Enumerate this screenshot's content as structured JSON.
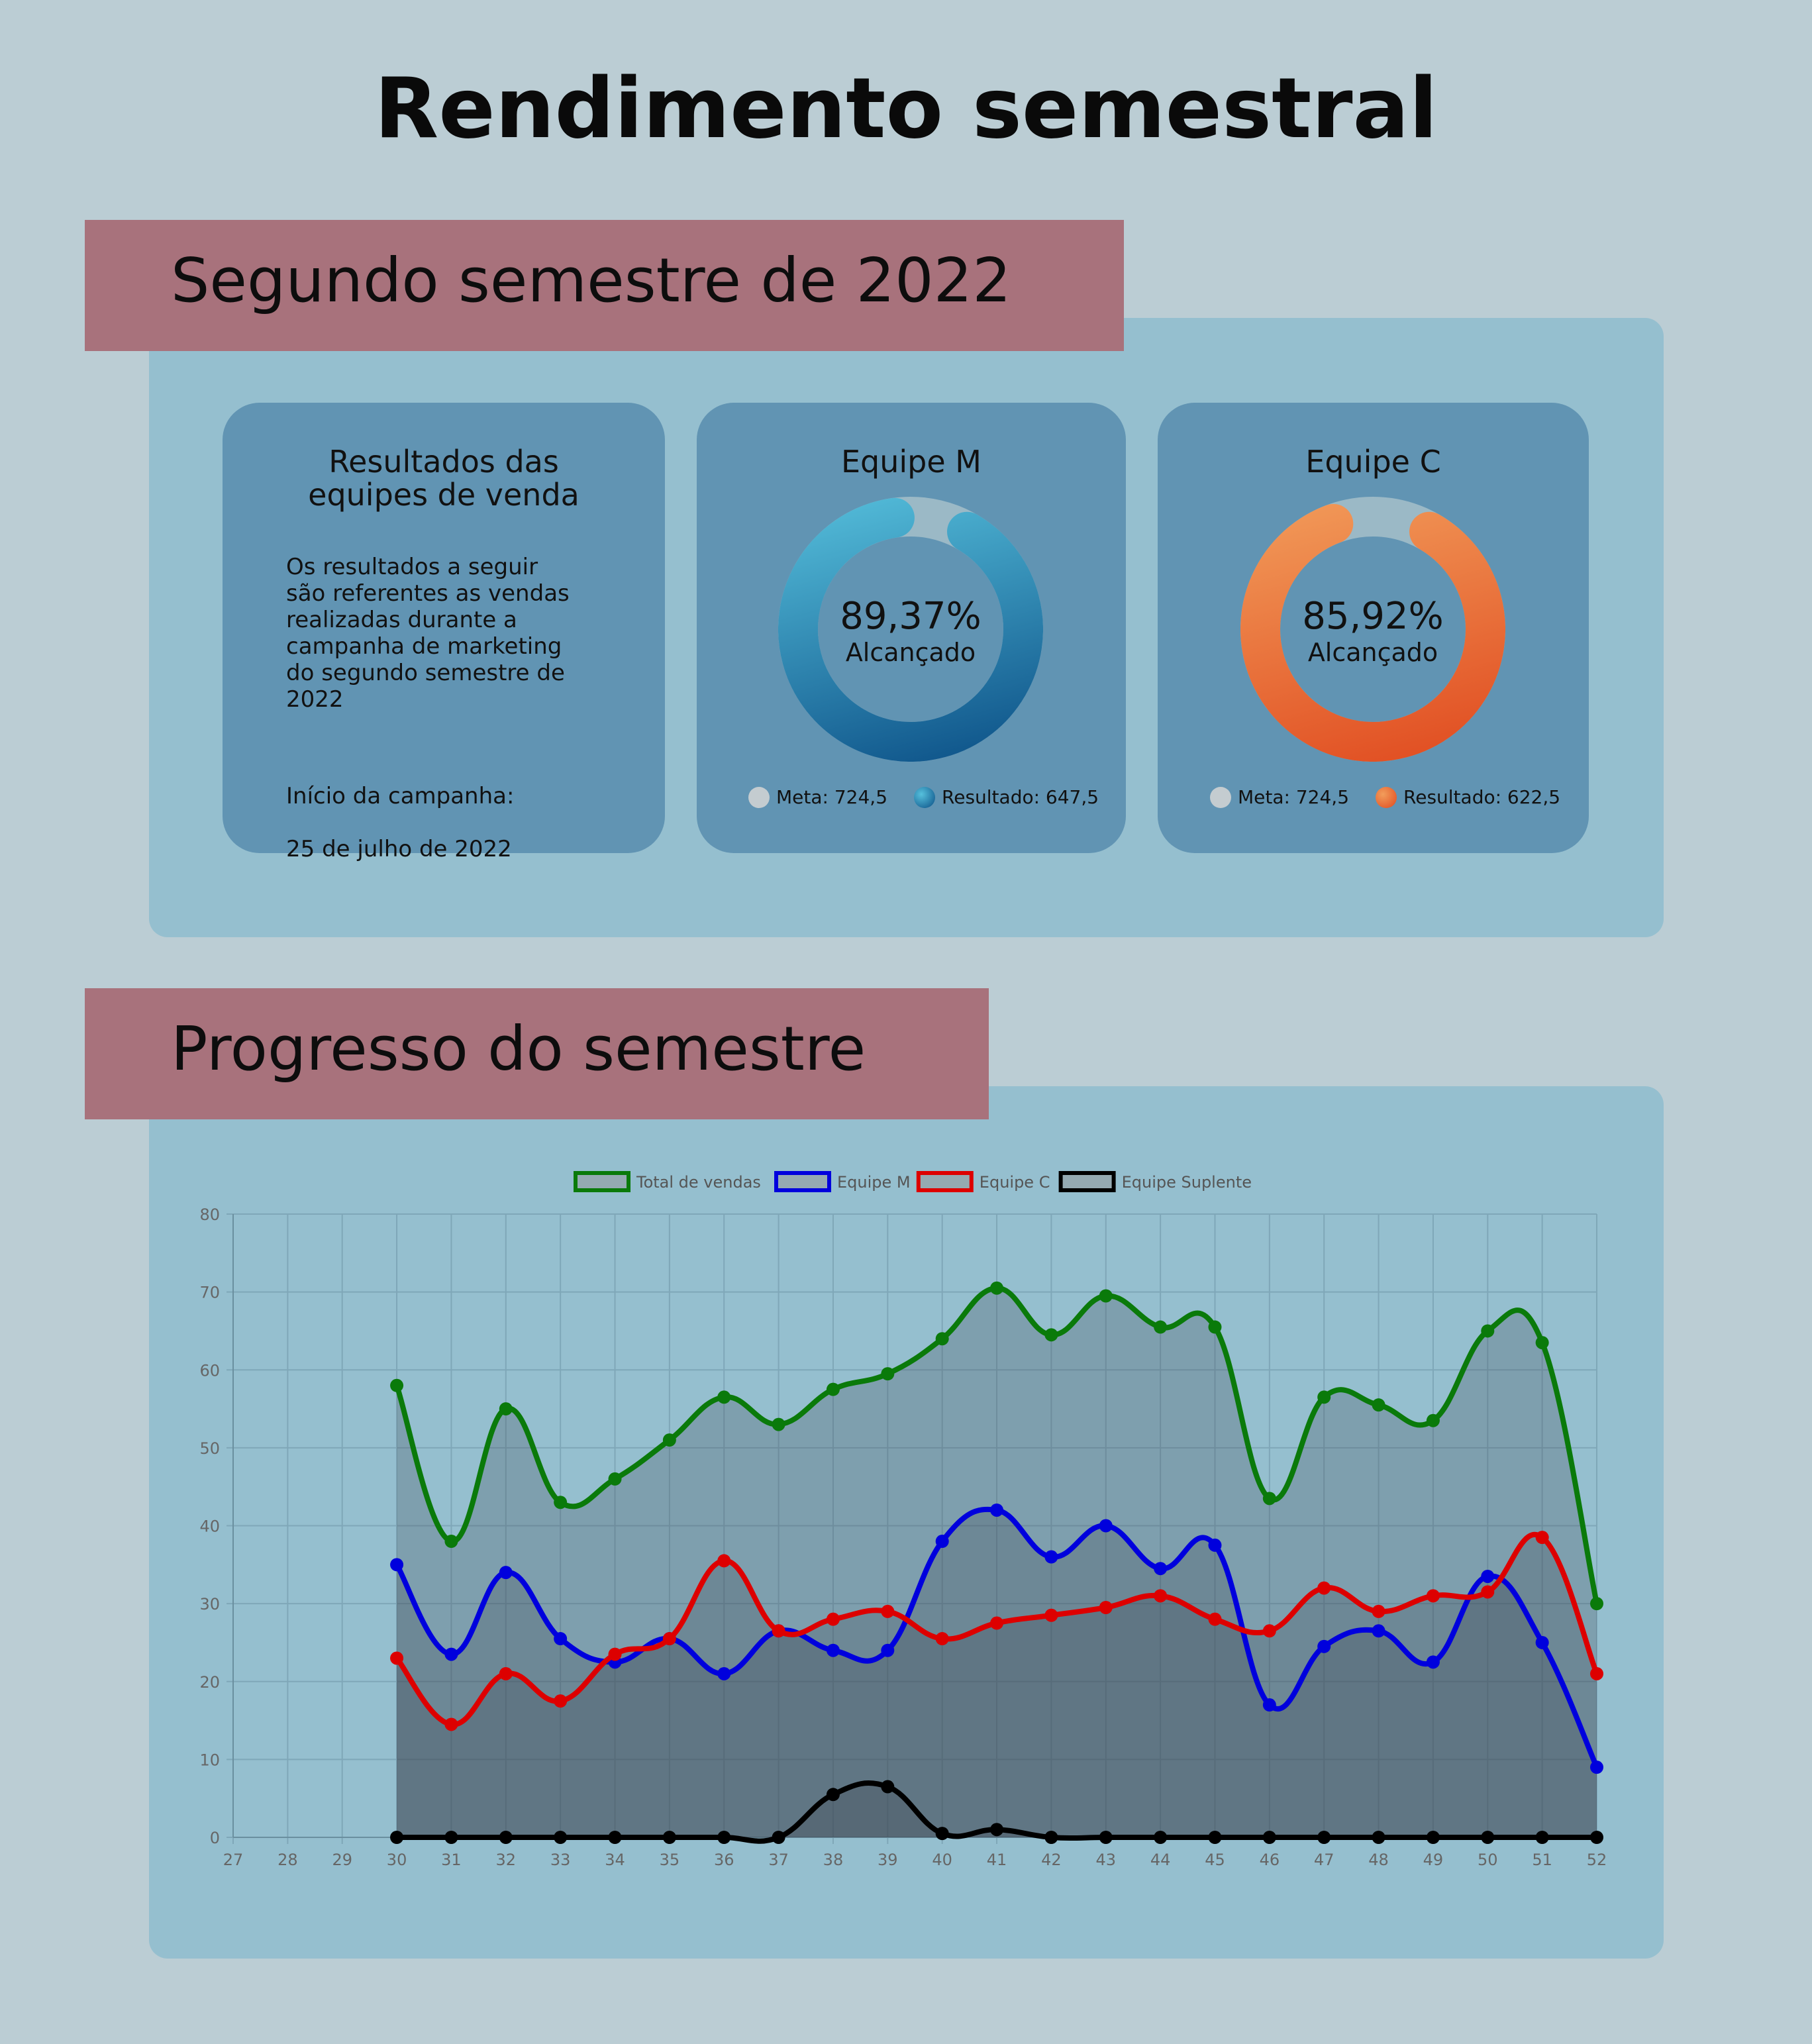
{
  "header": {
    "title": "Rendimento semestral"
  },
  "section1": {
    "banner": "Segundo semestre de 2022",
    "info_card": {
      "title_line1": "Resultados das",
      "title_line2": "equipes de venda",
      "body": "Os resultados a seguir\nsão referentes as vendas\nrealizadas durante a\ncampanha de marketing\ndo segundo semestre de\n2022",
      "start_label": "Início da campanha:",
      "start_date": "25 de julho de 2022"
    },
    "team_m": {
      "title": "Equipe M",
      "percent": "89,37%",
      "percent_value": 89.37,
      "status": "Alcançado",
      "meta_label": "Meta: 724,5",
      "result_label": "Resultado: 647,5",
      "color_start": "#56c0dc",
      "color_end": "#0b4f86"
    },
    "team_c": {
      "title": "Equipe C",
      "percent": "85,92%",
      "percent_value": 85.92,
      "status": "Alcançado",
      "meta_label": "Meta: 724,5",
      "result_label": "Resultado: 622,5",
      "color_start": "#f29d5b",
      "color_end": "#e04a1f"
    }
  },
  "section2": {
    "banner": "Progresso do semestre"
  },
  "chart_data": {
    "type": "line",
    "x_ticks": [
      "27",
      "28",
      "29",
      "30",
      "31",
      "32",
      "33",
      "34",
      "35",
      "36",
      "37",
      "38",
      "39",
      "40",
      "41",
      "42",
      "43",
      "44",
      "45",
      "46",
      "47",
      "48",
      "49",
      "50",
      "51",
      "52"
    ],
    "x": [
      30,
      31,
      32,
      33,
      34,
      35,
      36,
      37,
      38,
      39,
      40,
      41,
      42,
      43,
      44,
      45,
      46,
      47,
      48,
      49,
      50,
      51,
      52
    ],
    "xlim": [
      27,
      52
    ],
    "ylim": [
      0,
      80
    ],
    "y_ticks": [
      0,
      10,
      20,
      30,
      40,
      50,
      60,
      70,
      80
    ],
    "grid": true,
    "legend_position": "top",
    "series": [
      {
        "name": "Total de vendas",
        "color": "#0a7a0a",
        "fill": true,
        "values": [
          58,
          38,
          55,
          43,
          46,
          51,
          56.5,
          53,
          57.5,
          59.5,
          64,
          70.5,
          64.5,
          69.5,
          65.5,
          65.5,
          43.5,
          56.5,
          55.5,
          53.5,
          65,
          63.5,
          30
        ]
      },
      {
        "name": "Equipe M",
        "color": "#0000dd",
        "fill": false,
        "values": [
          35,
          23.5,
          34,
          25.5,
          22.5,
          25.5,
          21,
          26.5,
          24,
          24,
          38,
          42,
          36,
          40,
          34.5,
          37.5,
          17,
          24.5,
          26.5,
          22.5,
          33.5,
          25,
          9
        ]
      },
      {
        "name": "Equipe C",
        "color": "#dd0000",
        "fill": false,
        "values": [
          23,
          14.5,
          21,
          17.5,
          23.5,
          25.5,
          35.5,
          26.5,
          28,
          29,
          25.5,
          27.5,
          28.5,
          29.5,
          31,
          28,
          26.5,
          32,
          29,
          31,
          31.5,
          38.5,
          21
        ]
      },
      {
        "name": "Equipe Suplente",
        "color": "#000000",
        "fill": false,
        "values": [
          0,
          0,
          0,
          0,
          0,
          0,
          0,
          0,
          5.5,
          6.5,
          0.5,
          1,
          0,
          0,
          0,
          0,
          0,
          0,
          0,
          0,
          0,
          0,
          0
        ]
      }
    ]
  }
}
